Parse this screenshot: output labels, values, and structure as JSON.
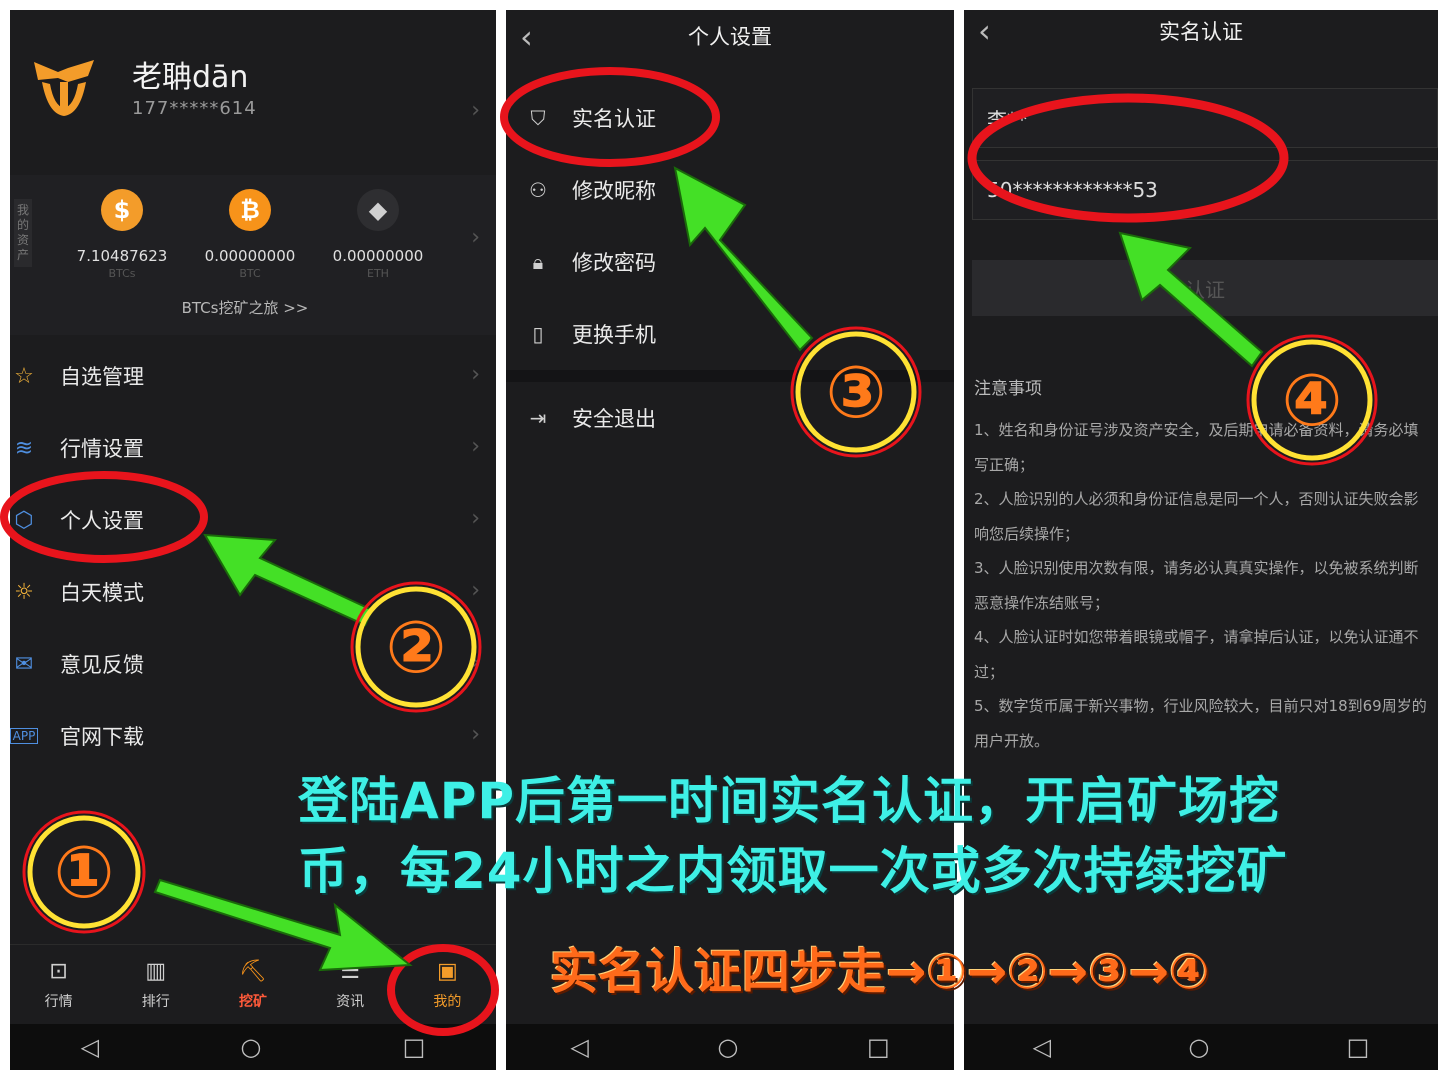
{
  "panel1": {
    "user": {
      "name": "老聃dān",
      "phone": "177*****614"
    },
    "assets_label": "我的资产",
    "coins": [
      {
        "icon": "dollar-coin-icon",
        "value": "7.10487623",
        "unit": "BTCs",
        "color": "#f39c2a"
      },
      {
        "icon": "bitcoin-icon",
        "value": "0.00000000",
        "unit": "BTC",
        "color": "#f7931a"
      },
      {
        "icon": "ethereum-icon",
        "value": "0.00000000",
        "unit": "ETH",
        "color": "#9b9b9b"
      }
    ],
    "mining_link": "BTCs挖矿之旅 >>",
    "menu": [
      {
        "icon": "star-icon",
        "label": "自选管理"
      },
      {
        "icon": "layers-icon",
        "label": "行情设置"
      },
      {
        "icon": "hexagon-settings-icon",
        "label": "个人设置"
      },
      {
        "icon": "sun-icon",
        "label": "白天模式"
      },
      {
        "icon": "mail-icon",
        "label": "意见反馈"
      },
      {
        "icon": "app-download-icon",
        "label": "官网下载"
      }
    ],
    "tabs": [
      {
        "icon": "chart-icon",
        "label": "行情"
      },
      {
        "icon": "ranking-icon",
        "label": "排行"
      },
      {
        "icon": "mining-icon",
        "label": "挖矿"
      },
      {
        "icon": "news-icon",
        "label": "资讯"
      },
      {
        "icon": "profile-icon",
        "label": "我的"
      }
    ]
  },
  "panel2": {
    "title": "个人设置",
    "menu": [
      {
        "icon": "shield-icon",
        "label": "实名认证"
      },
      {
        "icon": "person-icon",
        "label": "修改昵称"
      },
      {
        "icon": "lock-icon",
        "label": "修改密码"
      },
      {
        "icon": "phone-icon",
        "label": "更换手机"
      }
    ],
    "logout": {
      "icon": "exit-icon",
      "label": "安全退出"
    }
  },
  "panel3": {
    "title": "实名认证",
    "name_value": "李**",
    "id_value": "50************53",
    "submit_label": "认证",
    "notice_title": "注意事项",
    "notices": [
      "1、姓名和身份证号涉及资产安全，及后期申请必备资料，请务必填写正确；",
      "2、人脸识别的人必须和身份证信息是同一个人，否则认证失败会影响您后续操作；",
      "3、人脸识别使用次数有限，请务必认真真实操作，以免被系统判断恶意操作冻结账号；",
      "4、人脸认证时如您带着眼镜或帽子，请拿掉后认证，以免认证通不过；",
      "5、数字货币属于新兴事物，行业风险较大，目前只对18到69周岁的用户开放。"
    ]
  },
  "overlay": {
    "caption_line1": "登陆APP后第一时间实名认证，开启矿场挖",
    "caption_line2": "币，每24小时之内领取一次或多次持续挖矿",
    "steps": "实名认证四步走→①→②→③→④",
    "numbers": [
      "①",
      "②",
      "③",
      "④"
    ],
    "caption_color": "#3ef0e6",
    "arrow_color": "#44e026",
    "circle_color": "#e8141c"
  },
  "system_nav": {
    "back": "◁",
    "home": "○",
    "recent": "□"
  }
}
